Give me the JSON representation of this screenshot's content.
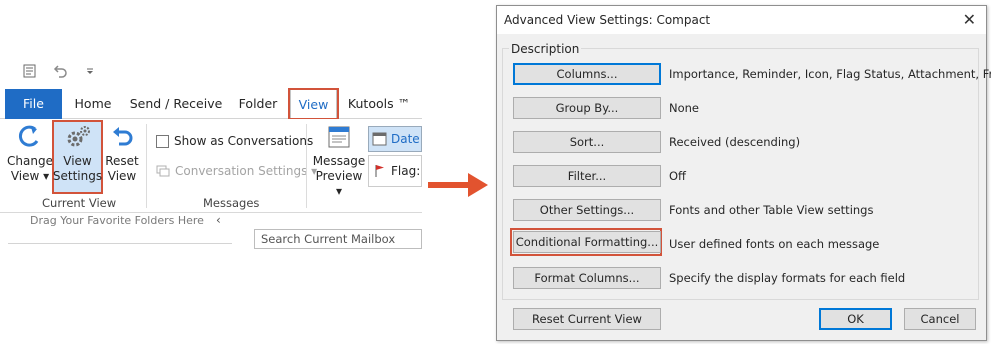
{
  "ribbon": {
    "qat": [
      "send-receive-icon",
      "undo-icon",
      "customize-qat-icon"
    ],
    "tabs": [
      "File",
      "Home",
      "Send / Receive",
      "Folder",
      "View",
      "Kutools ™"
    ],
    "active_tab": "View",
    "current_view": {
      "change_view": [
        "Change",
        "View ▾"
      ],
      "view_settings": [
        "View",
        "Settings"
      ],
      "reset_view": [
        "Reset",
        "View"
      ],
      "group_label": "Current View"
    },
    "messages": {
      "show_as_conversations": "Show as Conversations",
      "conversation_settings": "Conversation Settings ▾",
      "group_label": "Messages"
    },
    "arrangement": {
      "message_preview": [
        "Message",
        "Preview ▾"
      ],
      "date": "Date",
      "flag": "Flag:"
    },
    "favorites_hint": "Drag Your Favorite Folders Here",
    "search_placeholder": "Search Current Mailbox"
  },
  "dialog": {
    "title": "Advanced View Settings: Compact",
    "description_legend": "Description",
    "rows": [
      {
        "button": "Columns...",
        "desc": "Importance, Reminder, Icon, Flag Status, Attachment, Fr..."
      },
      {
        "button": "Group By...",
        "desc": "None"
      },
      {
        "button": "Sort...",
        "desc": "Received (descending)"
      },
      {
        "button": "Filter...",
        "desc": "Off"
      },
      {
        "button": "Other Settings...",
        "desc": "Fonts and other Table View settings"
      },
      {
        "button": "Conditional Formatting...",
        "desc": "User defined fonts on each message"
      },
      {
        "button": "Format Columns...",
        "desc": "Specify the display formats for each field"
      }
    ],
    "reset_button": "Reset Current View",
    "ok_button": "OK",
    "cancel_button": "Cancel"
  },
  "colors": {
    "accent_blue": "#1f6cc5",
    "highlight_red": "#d2533a",
    "arrow_orange": "#e2532f"
  }
}
